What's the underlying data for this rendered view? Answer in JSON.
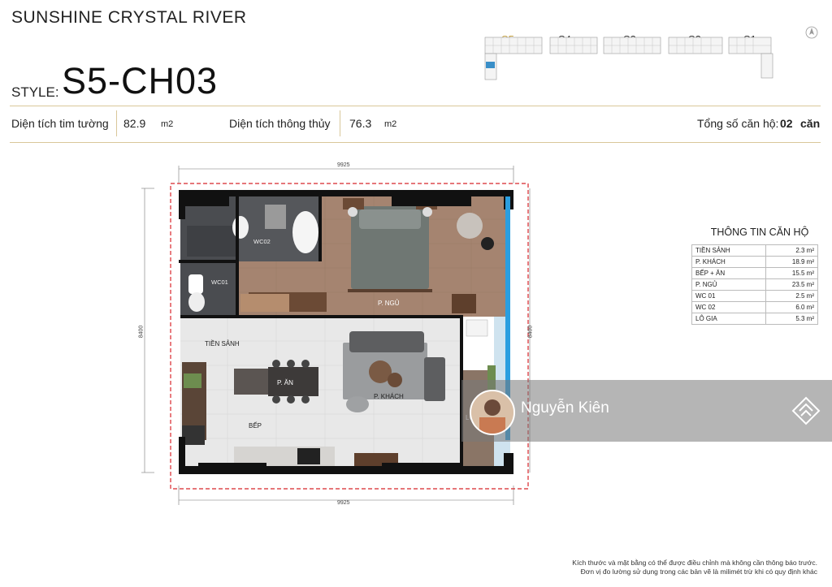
{
  "header": {
    "project_name": "SUNSHINE CRYSTAL RIVER",
    "style_label": "STYLE:",
    "style_code": "S5-CH03"
  },
  "keyplan": {
    "towers": [
      "S5",
      "S4",
      "S3",
      "S2",
      "S1"
    ],
    "active": "S5"
  },
  "areas": {
    "wall_area_label": "Diện tích tim tường",
    "wall_area_value": "82.9",
    "wall_area_unit": "m2",
    "clear_area_label": "Diện tích thông thủy",
    "clear_area_value": "76.3",
    "clear_area_unit": "m2",
    "units_label": "Tổng số căn hộ:",
    "units_value": "02",
    "units_suffix": "căn"
  },
  "floorplan": {
    "dim_top": "9925",
    "dim_bottom": "9925",
    "dim_left": "8400",
    "dim_right": "8400",
    "rooms": {
      "wc02": "WC02",
      "wc01": "WC01",
      "bedroom": "P. NGỦ",
      "foyer": "TIỀN SẢNH",
      "dining": "P. ĂN",
      "living": "P. KHÁCH",
      "kitchen": "BẾP",
      "loggia": "LÔ"
    }
  },
  "info": {
    "title": "THÔNG TIN CĂN HỘ",
    "rows": [
      {
        "name": "TIỀN SẢNH",
        "value": "2.3 m²"
      },
      {
        "name": "P. KHÁCH",
        "value": "18.9 m²"
      },
      {
        "name": "BẾP + ĂN",
        "value": "15.5 m²"
      },
      {
        "name": "P. NGỦ",
        "value": "23.5 m²"
      },
      {
        "name": "WC 01",
        "value": "2.5 m²"
      },
      {
        "name": "WC 02",
        "value": "6.0 m²"
      },
      {
        "name": "LÔ GIA",
        "value": "5.3 m²"
      }
    ]
  },
  "watermark": {
    "name": "Nguyễn Kiên"
  },
  "footer": {
    "note_line1": "Kích thước và mặt bằng có thể được điều chỉnh mà không cần thông báo trước.",
    "note_line2": "Đơn vị đo lường sử dụng trong các bản vẽ là milimét trừ khi có quy định khác"
  },
  "colors": {
    "gold": "#d9c79a",
    "wall": "#111111",
    "bedroom_floor": "#a58470",
    "living_floor": "#e6e6e6",
    "wc_floor": "#4a4c50",
    "highlight_red": "#d8262b"
  }
}
